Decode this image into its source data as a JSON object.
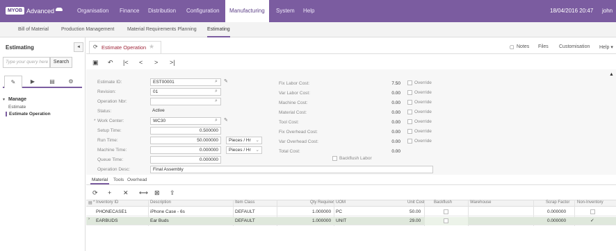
{
  "topnav": {
    "logo_box": "MYOB",
    "logo_text": "Advanced",
    "items": [
      "Organisation",
      "Finance",
      "Distribution",
      "Configuration",
      "Manufacturing",
      "System",
      "Help"
    ],
    "datetime": "18/04/2016 20:47",
    "user": "john"
  },
  "subnav": {
    "items": [
      "Bill of Material",
      "Production Management",
      "Material Requirements Planning",
      "Estimating"
    ]
  },
  "sidebar": {
    "title": "Estimating",
    "collapse": "◄",
    "search_placeholder": "Type your query here",
    "search_button": "Search",
    "group": "Manage",
    "links": [
      "Estimate",
      "Estimate Operation"
    ]
  },
  "screen": {
    "title": "Estimate Operation",
    "actions": [
      "Notes",
      "Files",
      "Customisation",
      "Help ▾"
    ]
  },
  "form": {
    "estimate_id_label": "Estimate ID:",
    "estimate_id": "EST00001",
    "revision_label": "Revision:",
    "revision": "01",
    "operation_nbr_label": "Operation Nbr:",
    "operation_nbr": "",
    "status_label": "Status:",
    "status": "Active",
    "work_center_label": "Work Center:",
    "work_center": "WC30",
    "setup_time_label": "Setup Time:",
    "setup_time": "0.500000",
    "run_time_label": "Run Time:",
    "run_time": "50.000000",
    "run_time_unit": "Pieces / Hr",
    "machine_time_label": "Machine Time:",
    "machine_time": "0.000000",
    "machine_time_unit": "Pieces / Hr",
    "queue_time_label": "Queue Time:",
    "queue_time": "0.000000",
    "operation_desc_label": "Operation Desc:",
    "operation_desc": "Final Assembly",
    "costs": [
      {
        "label": "Fix Labor Cost:",
        "value": "7.50",
        "override": "Override"
      },
      {
        "label": "Var Labor Cost:",
        "value": "0.00",
        "override": "Override"
      },
      {
        "label": "Machine Cost:",
        "value": "0.00",
        "override": "Override"
      },
      {
        "label": "Material Cost:",
        "value": "0.00",
        "override": "Override"
      },
      {
        "label": "Tool Cost:",
        "value": "0.00",
        "override": "Override"
      },
      {
        "label": "Fix Overhead Cost:",
        "value": "0.00",
        "override": "Override"
      },
      {
        "label": "Var Overhead Cost:",
        "value": "0.00",
        "override": "Override"
      },
      {
        "label": "Total Cost:",
        "value": "0.00",
        "override": ""
      }
    ],
    "backflush_labor": "Backflush Labor"
  },
  "grid": {
    "tabs": [
      "Material",
      "Tools",
      "Overhead"
    ],
    "columns": [
      "Inventory ID",
      "Description",
      "Item Class",
      "Qty Required",
      "UOM",
      "Unit Cost",
      "Backflush",
      "Warehouse",
      "Scrap Factor",
      "Non-Inventory"
    ],
    "rows": [
      {
        "inventory_id": "PHONECASE1",
        "description": "iPhone Case - 6s",
        "item_class": "DEFAULT",
        "qty": "1.000000",
        "uom": "PC",
        "unit_cost": "50.00",
        "warehouse": "",
        "scrap": "0.000000",
        "non_inventory": ""
      },
      {
        "inventory_id": "EARBUDS",
        "description": "Ear Buds",
        "item_class": "DEFAULT",
        "qty": "1.000000",
        "uom": "UNIT",
        "unit_cost": "29.00",
        "warehouse": "",
        "scrap": "0.000000",
        "non_inventory": "✓"
      }
    ]
  },
  "colors": {
    "brand": "#7b5ca0",
    "title_accent": "#a0283c",
    "selected_row": "#dfe8dc"
  }
}
